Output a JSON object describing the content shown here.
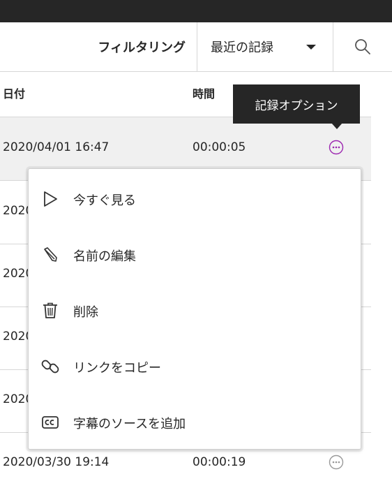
{
  "toolbar": {
    "filter_label": "フィルタリング",
    "sort_value": "最近の記録",
    "search_icon": "search-icon"
  },
  "table": {
    "columns": [
      "日付",
      "時間"
    ],
    "rows": [
      {
        "date": "2020/04/01 16:47",
        "time": "00:00:05",
        "selected": true
      },
      {
        "date": "2020/",
        "time": ""
      },
      {
        "date": "2020/",
        "time": ""
      },
      {
        "date": "2020/",
        "time": ""
      },
      {
        "date": "2020/",
        "time": ""
      },
      {
        "date": "2020/03/30 19:14",
        "time": "00:00:19"
      }
    ]
  },
  "tooltip": {
    "text": "記録オプション"
  },
  "menu": {
    "items": [
      {
        "icon": "play-icon",
        "label": "今すぐ見る"
      },
      {
        "icon": "pencil-icon",
        "label": "名前の編集"
      },
      {
        "icon": "trash-icon",
        "label": "削除"
      },
      {
        "icon": "link-icon",
        "label": "リンクをコピー"
      },
      {
        "icon": "closed-caption-icon",
        "label": "字幕のソースを追加"
      }
    ]
  },
  "colors": {
    "accent": "#9c27b0",
    "dark": "#262626",
    "border": "#d7d7d7"
  }
}
